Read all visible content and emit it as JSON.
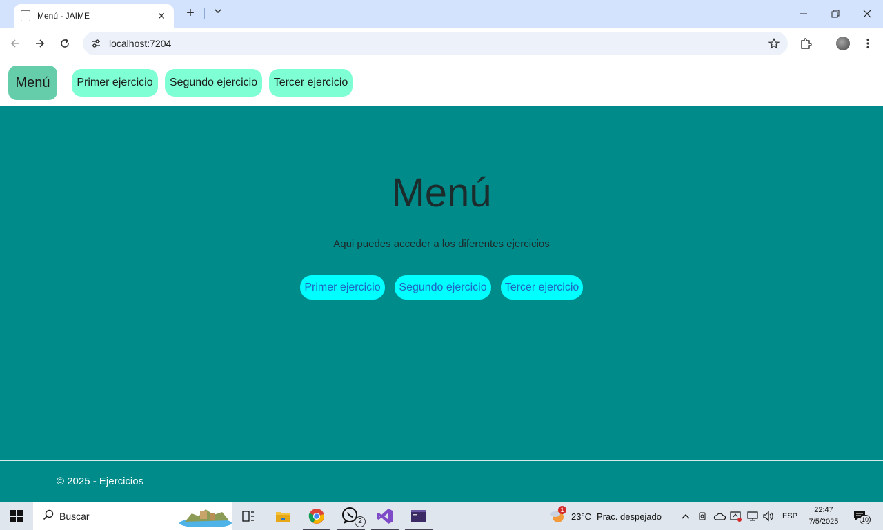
{
  "browser": {
    "tab_title": "Menú - JAIME",
    "url": "localhost:7204"
  },
  "site_nav": {
    "brand": "Menú",
    "links": [
      "Primer ejercicio",
      "Segundo ejercicio",
      "Tercer ejercicio"
    ]
  },
  "main": {
    "heading": "Menú",
    "subtitle": "Aqui puedes acceder a los diferentes ejercicios",
    "buttons": [
      "Primer ejercicio",
      "Segundo ejercicio",
      "Tercer ejercicio"
    ]
  },
  "footer": {
    "copyright": "© 2025 - Ejercicios"
  },
  "taskbar": {
    "search_label": "Buscar",
    "whatsapp_badge": "2",
    "weather_badge": "1",
    "weather_temp": "23°C",
    "weather_desc": "Prac. despejado",
    "language": "ESP",
    "time": "22:47",
    "date": "7/5/2025",
    "notifications": "10"
  },
  "colors": {
    "page_background": "#008b8b",
    "brand_background": "#66cdaa",
    "nav_link_background": "#7fffd4",
    "button_background": "#00ffff",
    "button_text": "#1f64c5"
  }
}
